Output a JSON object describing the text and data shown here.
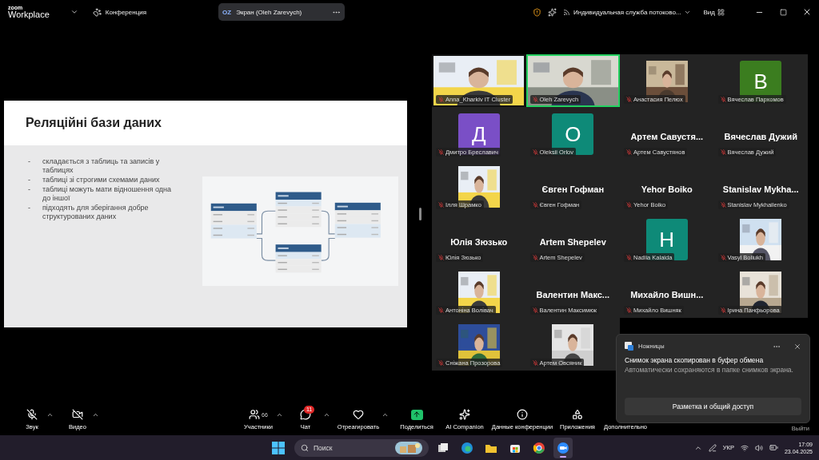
{
  "top_bar": {
    "logo": [
      "zoom",
      "Workplace"
    ],
    "meeting": "Конференция",
    "share_pill": {
      "initials": "OZ",
      "title": "Экран (Oleh Zarevych)"
    },
    "stream": "Индивидуальная служба потоково...",
    "view": "Вид"
  },
  "slide": {
    "title": "Реляційні бази даних",
    "bullets": [
      {
        "marker": "-",
        "text": "складається з таблиць та записів у таблицях"
      },
      {
        "marker": "-",
        "text": "таблиці зі строгими схемами даних"
      },
      {
        "marker": "-",
        "text": "таблиці можуть мати відношення одна до іншої"
      },
      {
        "marker": "-",
        "text": "підходять для зберігання добре структурованих даних"
      }
    ]
  },
  "gallery": {
    "tiles": [
      {
        "kind": "video",
        "label": "Anna_Kharkiv IT Cluster",
        "active": false
      },
      {
        "kind": "video",
        "label": "Oleh Zarevych",
        "active": true
      },
      {
        "kind": "video",
        "label": "Анастасия Пелюх",
        "active": false
      },
      {
        "kind": "avatar",
        "letter": "В",
        "color": "#3b7d1f",
        "label": "Вячеслав Пархомов",
        "active": false
      },
      {
        "kind": "avatar",
        "letter": "Д",
        "color": "#7a4fc6",
        "label": "Дмитро Бреславич",
        "active": false
      },
      {
        "kind": "avatar",
        "letter": "O",
        "color": "#0e8a78",
        "label": "Oleksii Orlov",
        "active": false
      },
      {
        "kind": "name",
        "display": "Артем  Савустя...",
        "label": "Артем Савустянов",
        "active": false
      },
      {
        "kind": "name",
        "display": "Вячеслав Дужий",
        "label": "Вячеслав Дужий",
        "active": false
      },
      {
        "kind": "video",
        "label": "Ілля Шрамко",
        "active": false
      },
      {
        "kind": "name",
        "display": "Євген Гофман",
        "label": "Євген Гофман",
        "active": false
      },
      {
        "kind": "name",
        "display": "Yehor Boiko",
        "label": "Yehor Boiko",
        "active": false
      },
      {
        "kind": "name",
        "display": "Stanislav  Mykha...",
        "label": "Stanislav Mykhailenko",
        "active": false
      },
      {
        "kind": "name",
        "display": "Юлія Зюзько",
        "label": "Юлія Зюзько",
        "active": false
      },
      {
        "kind": "name",
        "display": "Artem Shepelev",
        "label": "Artem Shepelev",
        "active": false
      },
      {
        "kind": "avatar",
        "letter": "H",
        "color": "#0e8a78",
        "label": "Nadiia Kalaida",
        "active": false
      },
      {
        "kind": "video",
        "label": "Vasyl Boliukh",
        "active": false
      },
      {
        "kind": "video",
        "label": "Антоніна Волівач",
        "active": false
      },
      {
        "kind": "name",
        "display": "Валентин  Макс...",
        "label": "Валентин Максимюк",
        "active": false
      },
      {
        "kind": "name",
        "display": "Михайло  Вишн...",
        "label": "Михайло Вишняк",
        "active": false
      },
      {
        "kind": "video",
        "label": "Ірина Панфьорова",
        "active": false
      },
      {
        "kind": "video",
        "label": "Сніжана Прозорова",
        "active": false
      },
      {
        "kind": "video",
        "label": "Артем Овсяник",
        "active": false
      }
    ]
  },
  "toolbar": {
    "left": [
      {
        "label": "Звук",
        "kind": "mic",
        "muted": true
      },
      {
        "label": "Видео",
        "kind": "video",
        "muted": true
      }
    ],
    "center": [
      {
        "label": "Участники",
        "kind": "participants",
        "count": "66",
        "caret": true
      },
      {
        "label": "Чат",
        "kind": "chat",
        "badge": "11",
        "caret": true
      },
      {
        "label": "Отреагировать",
        "kind": "react",
        "caret": true
      },
      {
        "label": "Поделиться",
        "kind": "share",
        "caret": false
      },
      {
        "label": "AI Companion",
        "kind": "ai",
        "caret": false
      },
      {
        "label": "Данные конференции",
        "kind": "info",
        "caret": false
      },
      {
        "label": "Приложения",
        "kind": "apps",
        "caret": false
      },
      {
        "label": "Дополнительно",
        "kind": "more",
        "caret": false
      }
    ],
    "leave": "Выйти"
  },
  "notification": {
    "app": "Ножницы",
    "title": "Снимок экрана скопирован в буфер обмена",
    "body": "Автоматически сохраняются в папке снимков экрана.",
    "button": "Разметка и общий доступ"
  },
  "taskbar": {
    "search": "Поиск",
    "apps": [
      {
        "kind": "taskview",
        "active": false
      },
      {
        "kind": "edge",
        "active": false
      },
      {
        "kind": "explorer",
        "active": false
      },
      {
        "kind": "store",
        "active": false
      },
      {
        "kind": "chrome",
        "active": false
      },
      {
        "kind": "zoom",
        "active": true
      }
    ],
    "language": "УКР",
    "time": "17:09",
    "date": "23.04.2025"
  }
}
